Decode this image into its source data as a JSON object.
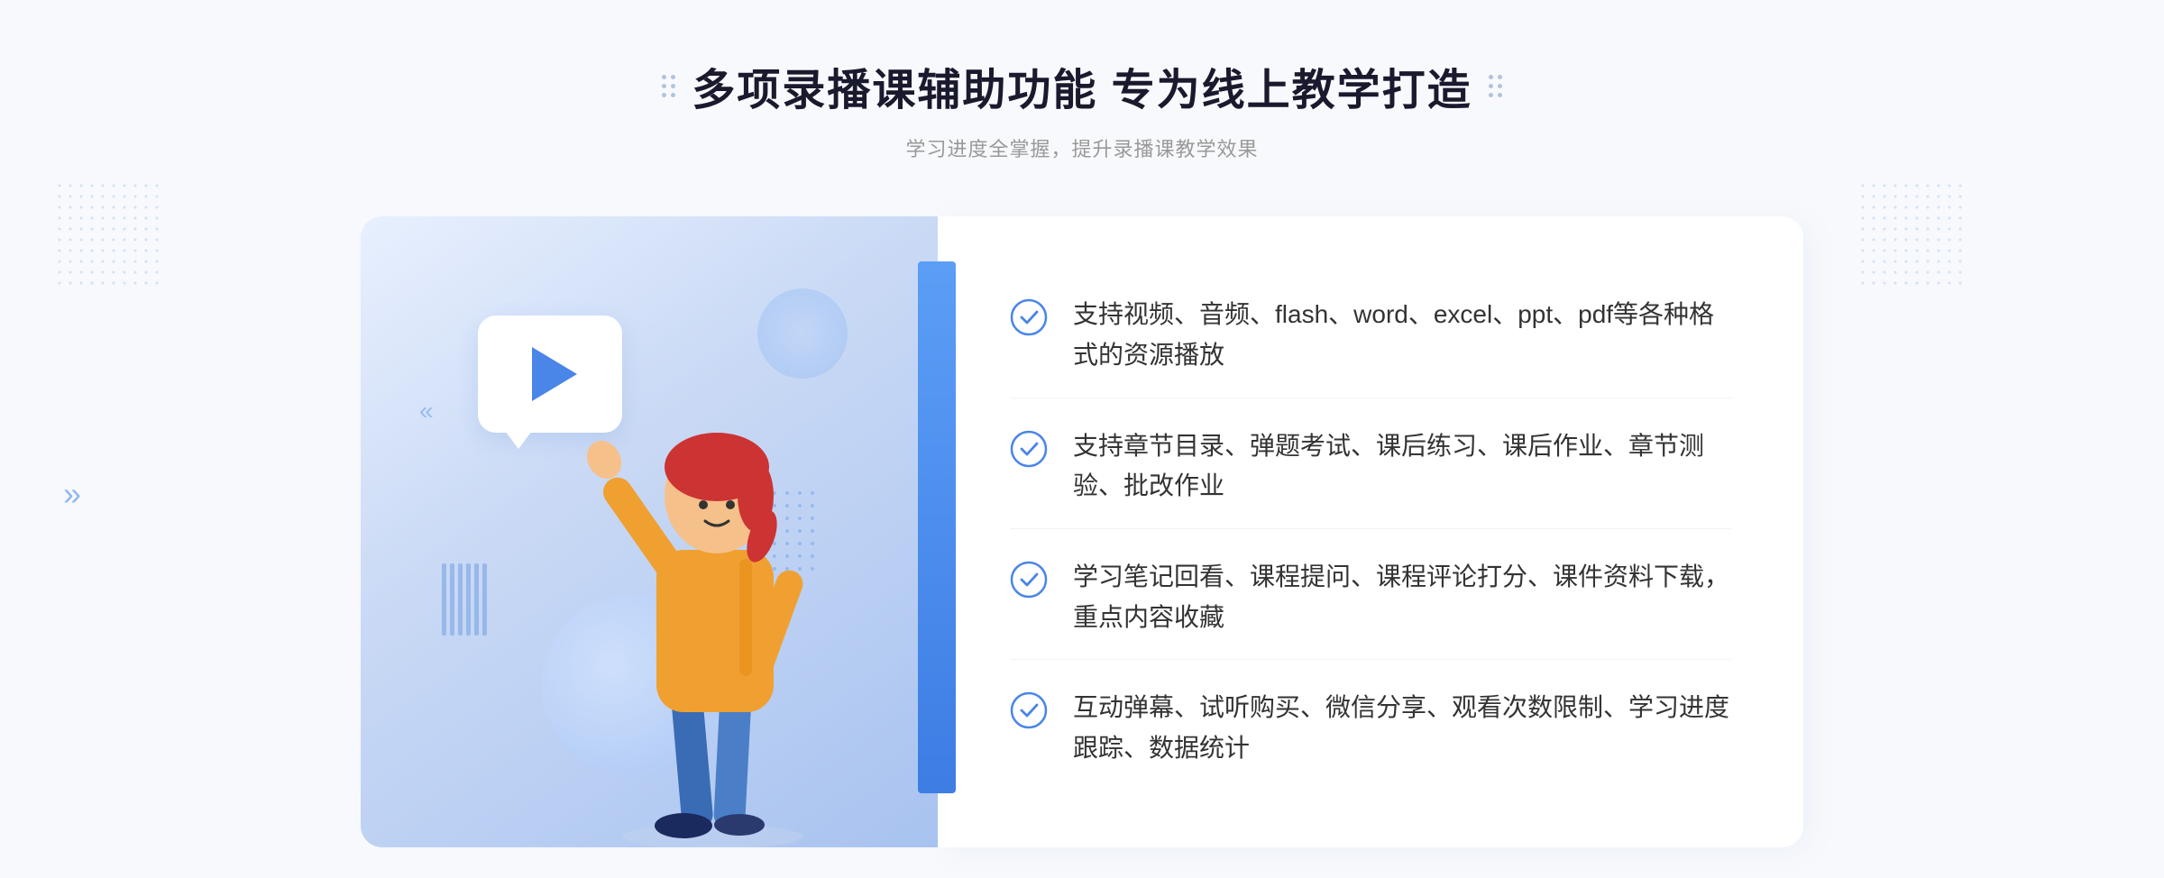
{
  "header": {
    "title": "多项录播课辅助功能 专为线上教学打造",
    "subtitle": "学习进度全掌握，提升录播课教学效果"
  },
  "features": [
    {
      "id": "feature-1",
      "text": "支持视频、音频、flash、word、excel、ppt、pdf等各种格式的资源播放"
    },
    {
      "id": "feature-2",
      "text": "支持章节目录、弹题考试、课后练习、课后作业、章节测验、批改作业"
    },
    {
      "id": "feature-3",
      "text": "学习笔记回看、课程提问、课程评论打分、课件资料下载，重点内容收藏"
    },
    {
      "id": "feature-4",
      "text": "互动弹幕、试听购买、微信分享、观看次数限制、学习进度跟踪、数据统计"
    }
  ],
  "decorators": {
    "arrow_left": "»",
    "dots_label": "decorator"
  }
}
